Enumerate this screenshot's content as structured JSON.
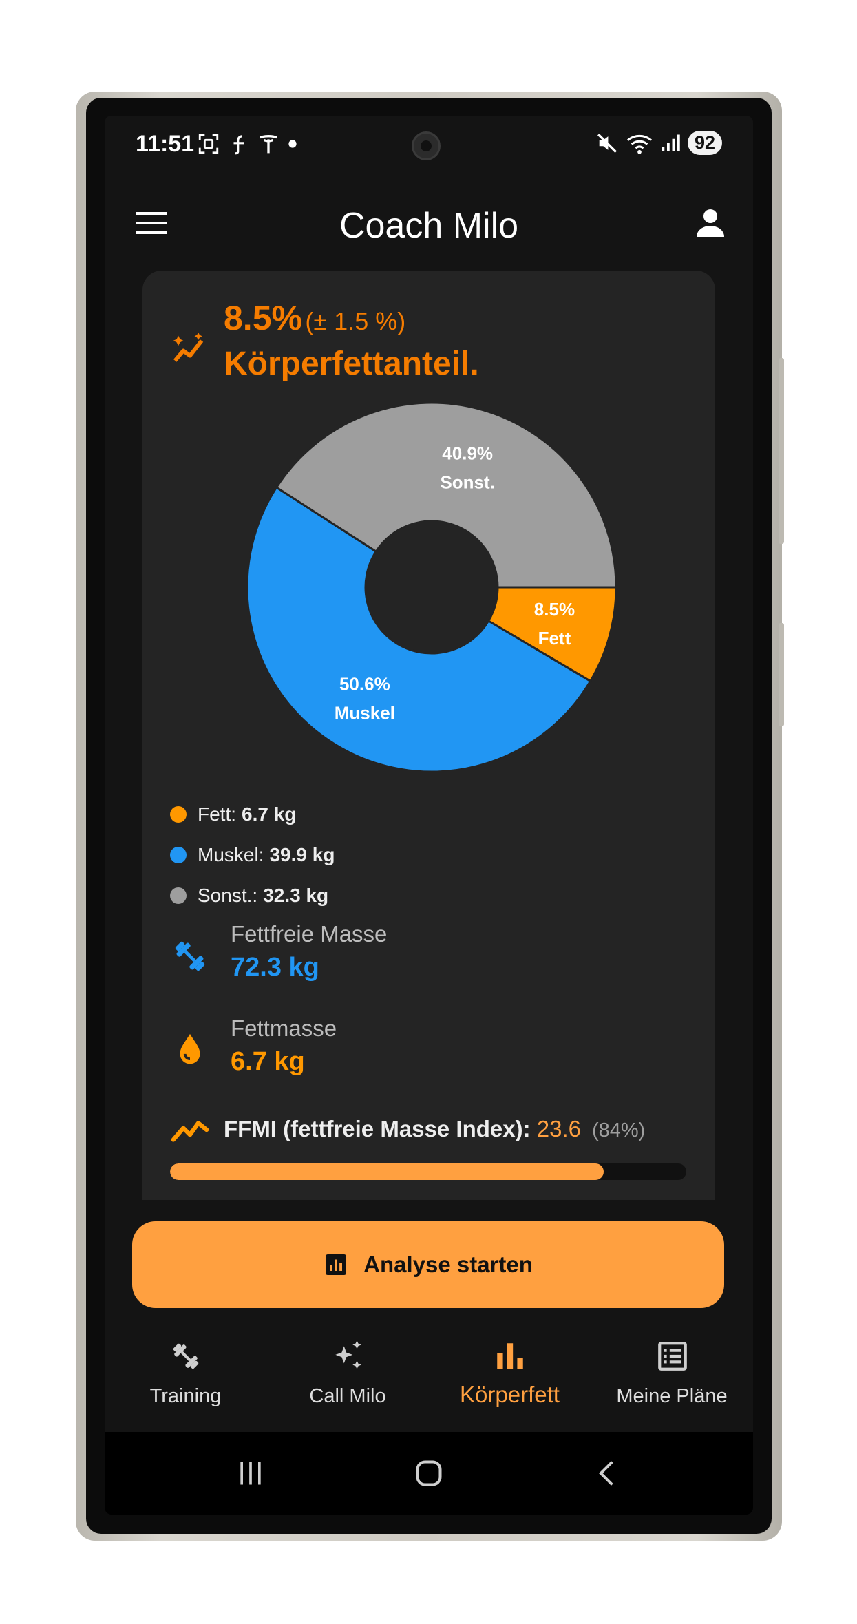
{
  "status_bar": {
    "time": "11:51",
    "battery": "92"
  },
  "app_bar": {
    "title": "Coach Milo"
  },
  "body_fat_card": {
    "headline_value": "8.5%",
    "headline_uncertainty": "(± 1.5 %)",
    "headline_label": "Körperfettanteil.",
    "accent_color": "#f57c00"
  },
  "chart_data": {
    "type": "pie",
    "donut": true,
    "slices": [
      {
        "label": "Fett",
        "percent": 8.5,
        "percent_label": "8.5%",
        "color": "#ff9800"
      },
      {
        "label": "Muskel",
        "percent": 50.6,
        "percent_label": "50.6%",
        "color": "#2196f3"
      },
      {
        "label": "Sonst.",
        "percent": 40.9,
        "percent_label": "40.9%",
        "color": "#9e9e9e"
      }
    ]
  },
  "legend": [
    {
      "label": "Fett:",
      "value": "6.7 kg",
      "color": "#ff9800"
    },
    {
      "label": "Muskel:",
      "value": "39.9 kg",
      "color": "#2196f3"
    },
    {
      "label": "Sonst.:",
      "value": "32.3 kg",
      "color": "#9e9e9e"
    }
  ],
  "stats": {
    "fat_free_mass": {
      "label": "Fettfreie Masse",
      "value": "72.3 kg",
      "icon": "dumbbell-icon",
      "color": "#2196f3"
    },
    "fat_mass": {
      "label": "Fettmasse",
      "value": "6.7 kg",
      "icon": "water-drop-icon",
      "color": "#ff9800"
    }
  },
  "ffmi": {
    "label": "FFMI (fettfreie Masse Index):",
    "value": "23.6",
    "percentile_label": "(84%)",
    "progress": 0.84
  },
  "action_button": {
    "label": "Analyse starten",
    "icon": "chart-box-icon",
    "color": "#ffa040"
  },
  "bottom_nav": {
    "items": [
      {
        "label": "Training",
        "icon": "dumbbell-icon",
        "active": false
      },
      {
        "label": "Call Milo",
        "icon": "sparkles-icon",
        "active": false
      },
      {
        "label": "Körperfett",
        "icon": "bar-chart-icon",
        "active": true
      },
      {
        "label": "Meine Pläne",
        "icon": "list-icon",
        "active": false
      }
    ]
  }
}
